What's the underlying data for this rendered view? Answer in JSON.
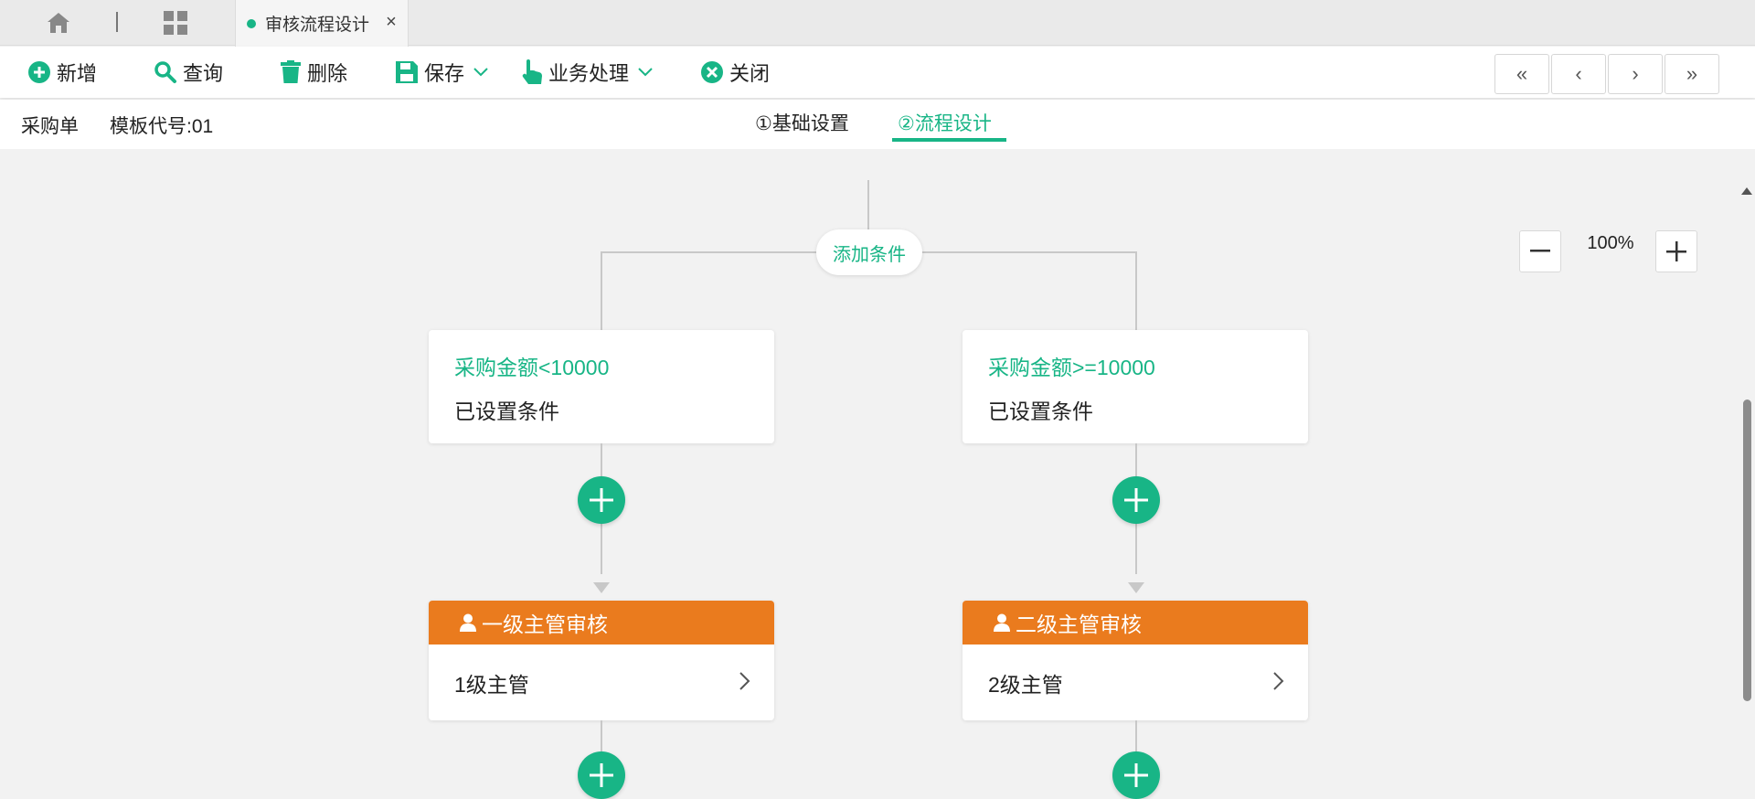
{
  "tabbar": {
    "active_tab_label": "审核流程设计",
    "close_glyph": "×"
  },
  "toolbar": {
    "add_label": "新增",
    "query_label": "查询",
    "delete_label": "删除",
    "save_label": "保存",
    "business_label": "业务处理",
    "close_label": "关闭",
    "nav": {
      "first": "«",
      "prev": "‹",
      "next": "›",
      "last": "»"
    }
  },
  "info": {
    "doc_type": "采购单",
    "template_code": "模板代号:01",
    "steps": [
      "①基础设置",
      "②流程设计"
    ],
    "active_step": 1
  },
  "flow": {
    "add_condition_label": "添加条件",
    "branches": [
      {
        "condition_title": "采购金额<10000",
        "condition_status": "已设置条件",
        "approver_title": "一级主管审核",
        "approver_value": "1级主管"
      },
      {
        "condition_title": "采购金额>=10000",
        "condition_status": "已设置条件",
        "approver_title": "二级主管审核",
        "approver_value": "2级主管"
      }
    ]
  },
  "zoom": {
    "value": "100%"
  },
  "colors": {
    "accent": "#18b586",
    "approver_header": "#ea7b1e",
    "connector": "#c8c8c8"
  }
}
